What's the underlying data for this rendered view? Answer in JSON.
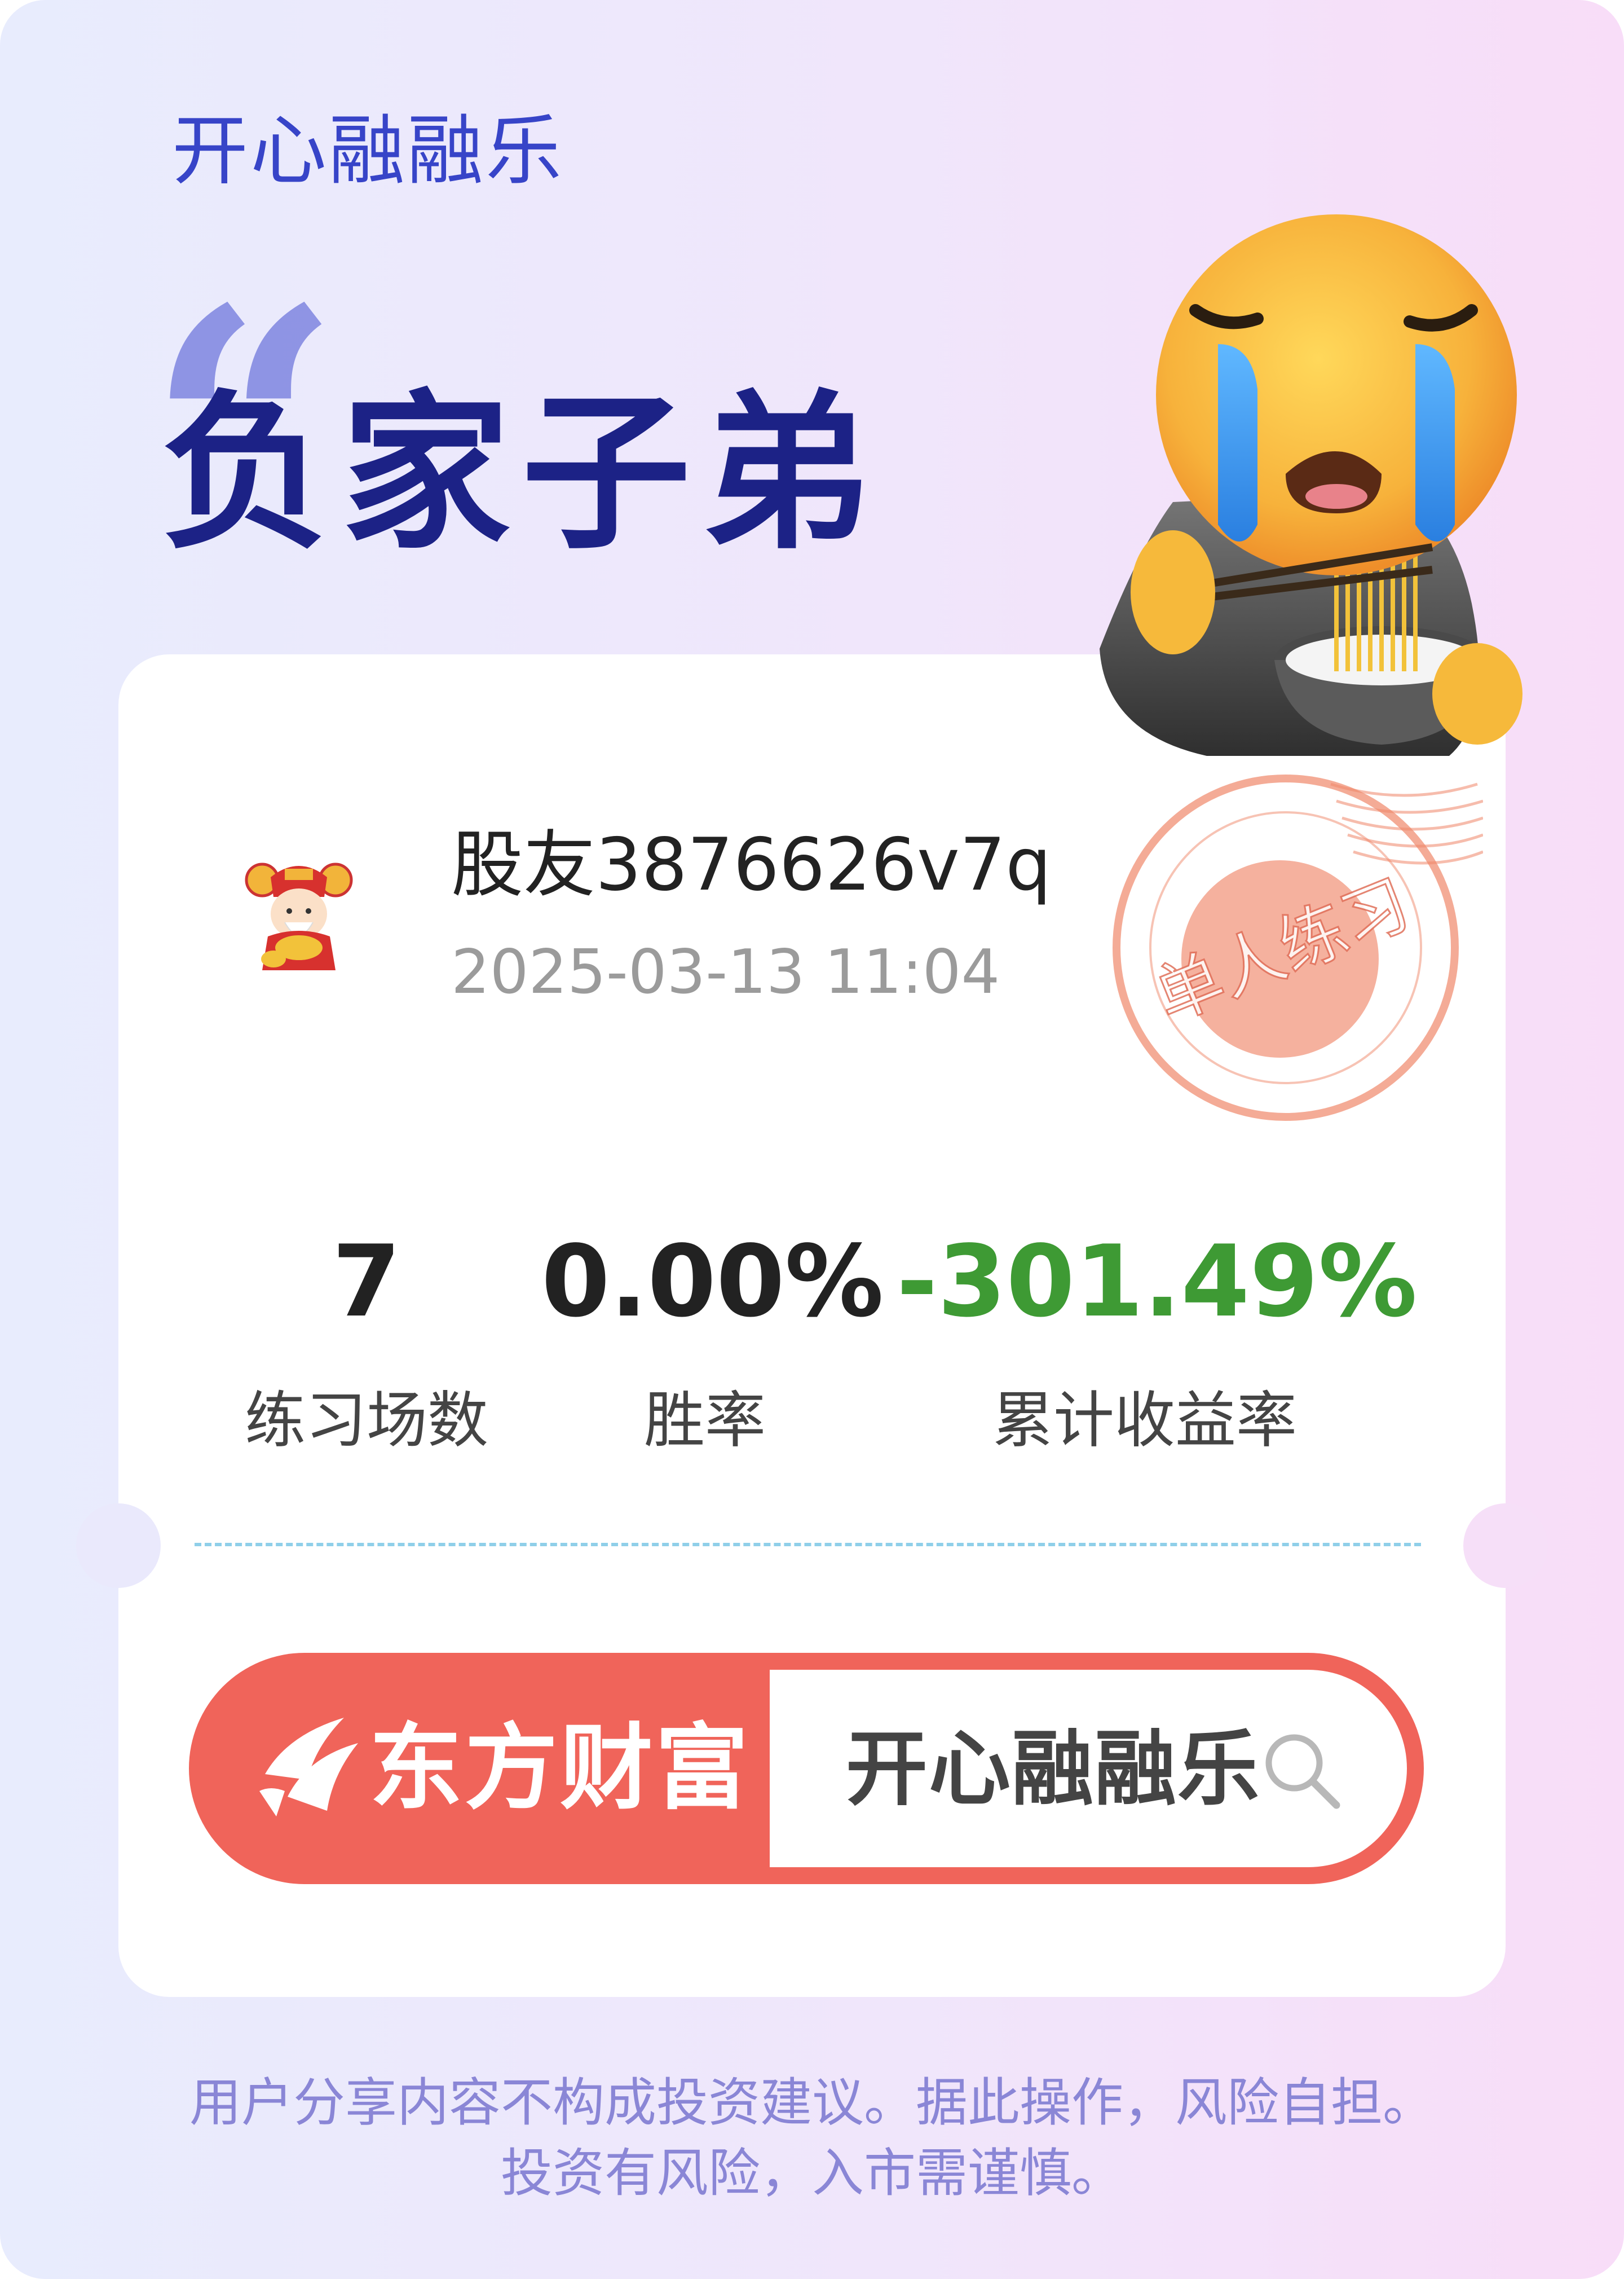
{
  "header": {
    "app_title": "开心融融乐",
    "quote_mark": "“",
    "badge_title": "负家子弟"
  },
  "sticker": {
    "icon": "crying-face-eating-noodles-icon",
    "stamp_text": "单人练习",
    "stamp_color": "#f0876a"
  },
  "profile": {
    "avatar_icon": "god-of-wealth-avatar",
    "user_name": "股友3876626v7q",
    "timestamp": "2025-03-13 11:04"
  },
  "stats": [
    {
      "value": "7",
      "label": "练习场数"
    },
    {
      "value": "0.00%",
      "label": "胜率"
    },
    {
      "value": "-301.49%",
      "label": "累计收益率",
      "color": "#3e9a34"
    }
  ],
  "search_banner": {
    "brand_icon": "eastmoney-logo-icon",
    "brand_name": "东方财富",
    "query": "开心融融乐",
    "search_icon": "search-icon",
    "brand_color": "#f0645a"
  },
  "disclaimer": {
    "line1": "用户分享内容不构成投资建议。据此操作，风险自担。",
    "line2": "投资有风险，入市需谨慎。"
  }
}
